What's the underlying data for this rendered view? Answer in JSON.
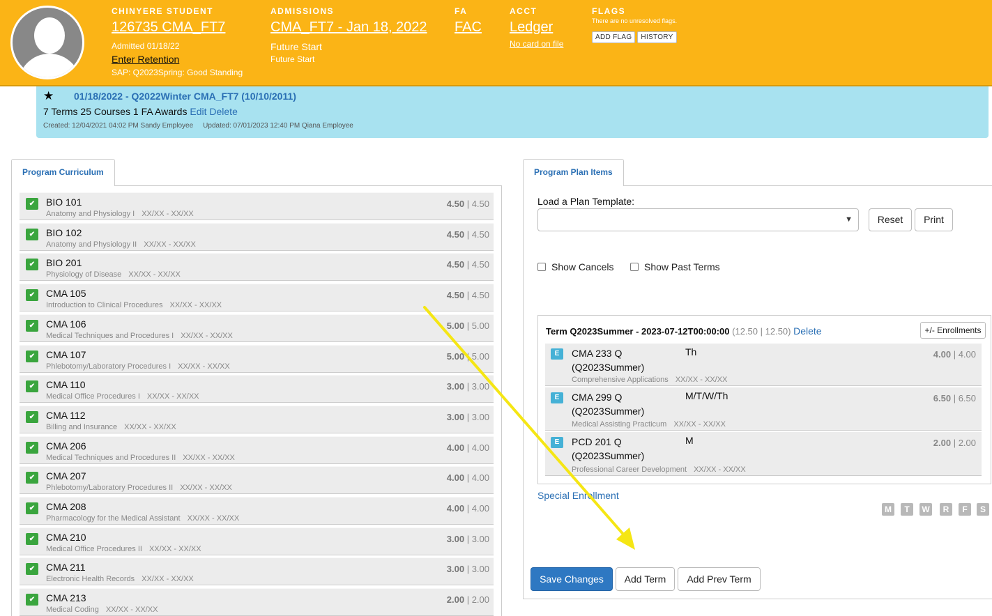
{
  "header": {
    "student_label": "CHINYERE STUDENT",
    "student_id": "126735 CMA_FT7",
    "admitted": "Admitted 01/18/22",
    "enter_retention": "Enter Retention",
    "sap": "SAP: Q2023Spring: Good Standing",
    "admissions_label": "ADMISSIONS",
    "admissions_link": "CMA_FT7 - Jan 18, 2022",
    "admissions_status1": "Future Start",
    "admissions_status2": "Future Start",
    "fa_label": "FA",
    "fa_link": "FAC",
    "acct_label": "ACCT",
    "acct_link": "Ledger",
    "acct_card": "No card on file",
    "flags_label": "FLAGS",
    "flags_text": "There are no unresolved flags.",
    "add_flag": "ADD FLAG",
    "history": "HISTORY",
    "header_color": "#fbb416"
  },
  "banner": {
    "star": "★",
    "title": "01/18/2022 - Q2022Winter CMA_FT7 (10/10/2011)",
    "summary": "7 Terms 25 Courses 1 FA Awards",
    "edit": "Edit",
    "delete": "Delete",
    "created": "Created: 12/04/2021 04:02 PM Sandy Employee",
    "updated": "Updated: 07/01/2023 12:40 PM Qiana Employee"
  },
  "curriculum": {
    "tab_label": "Program Curriculum",
    "courses": [
      {
        "code": "BIO 101",
        "name": "Anatomy and Physiology I",
        "dates": "XX/XX - XX/XX",
        "credits": "4.50",
        "credits2": "4.50"
      },
      {
        "code": "BIO 102",
        "name": "Anatomy and Physiology II",
        "dates": "XX/XX - XX/XX",
        "credits": "4.50",
        "credits2": "4.50"
      },
      {
        "code": "BIO 201",
        "name": "Physiology of Disease",
        "dates": "XX/XX - XX/XX",
        "credits": "4.50",
        "credits2": "4.50"
      },
      {
        "code": "CMA 105",
        "name": "Introduction to Clinical Procedures",
        "dates": "XX/XX - XX/XX",
        "credits": "4.50",
        "credits2": "4.50"
      },
      {
        "code": "CMA 106",
        "name": "Medical Techniques and Procedures I",
        "dates": "XX/XX - XX/XX",
        "credits": "5.00",
        "credits2": "5.00"
      },
      {
        "code": "CMA 107",
        "name": "Phlebotomy/Laboratory Procedures I",
        "dates": "XX/XX - XX/XX",
        "credits": "5.00",
        "credits2": "5.00"
      },
      {
        "code": "CMA 110",
        "name": "Medical Office Procedures I",
        "dates": "XX/XX - XX/XX",
        "credits": "3.00",
        "credits2": "3.00"
      },
      {
        "code": "CMA 112",
        "name": "Billing and Insurance",
        "dates": "XX/XX - XX/XX",
        "credits": "3.00",
        "credits2": "3.00"
      },
      {
        "code": "CMA 206",
        "name": "Medical Techniques and Procedures II",
        "dates": "XX/XX - XX/XX",
        "credits": "4.00",
        "credits2": "4.00"
      },
      {
        "code": "CMA 207",
        "name": "Phlebotomy/Laboratory Procedures II",
        "dates": "XX/XX - XX/XX",
        "credits": "4.00",
        "credits2": "4.00"
      },
      {
        "code": "CMA 208",
        "name": "Pharmacology for the Medical Assistant",
        "dates": "XX/XX - XX/XX",
        "credits": "4.00",
        "credits2": "4.00"
      },
      {
        "code": "CMA 210",
        "name": "Medical Office Procedures II",
        "dates": "XX/XX - XX/XX",
        "credits": "3.00",
        "credits2": "3.00"
      },
      {
        "code": "CMA 211",
        "name": "Electronic Health Records",
        "dates": "XX/XX - XX/XX",
        "credits": "3.00",
        "credits2": "3.00"
      },
      {
        "code": "CMA 213",
        "name": "Medical Coding",
        "dates": "XX/XX - XX/XX",
        "credits": "2.00",
        "credits2": "2.00"
      }
    ]
  },
  "plan": {
    "tab_label": "Program Plan Items",
    "load_template_label": "Load a Plan Template:",
    "template_value": "",
    "reset": "Reset",
    "print": "Print",
    "show_cancels": "Show Cancels",
    "show_past_terms": "Show Past Terms",
    "term_title": "Term Q2023Summer - 2023-07-12T00:00:00",
    "term_credits": "(12.50 | 12.50)",
    "term_delete": "Delete",
    "enrollments_button": "+/- Enrollments",
    "enrollments": [
      {
        "badge": "E",
        "code": "CMA 233 Q (Q2023Summer)",
        "days": "Th",
        "name": "Comprehensive Applications",
        "dates": "XX/XX - XX/XX",
        "credits": "4.00",
        "credits2": "4.00"
      },
      {
        "badge": "E",
        "code": "CMA 299 Q (Q2023Summer)",
        "days": "M/T/W/Th",
        "name": "Medical Assisting Practicum",
        "dates": "XX/XX - XX/XX",
        "credits": "6.50",
        "credits2": "6.50"
      },
      {
        "badge": "E",
        "code": "PCD 201 Q (Q2023Summer)",
        "days": "M",
        "name": "Professional Career Development",
        "dates": "XX/XX - XX/XX",
        "credits": "2.00",
        "credits2": "2.00"
      }
    ],
    "special_enrollment": "Special Enrollment",
    "days": [
      "M",
      "T",
      "W",
      "R",
      "F",
      "S"
    ],
    "save_changes": "Save Changes",
    "add_term": "Add Term",
    "add_prev_term": "Add Prev Term"
  },
  "annotation": {
    "arrow_color": "#f5e614"
  }
}
